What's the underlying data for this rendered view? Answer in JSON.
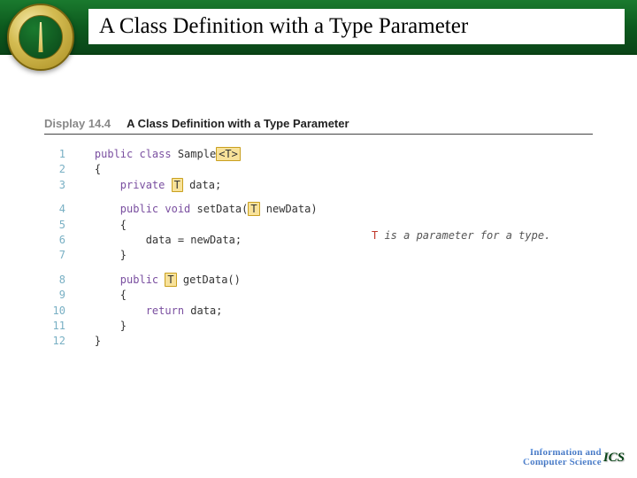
{
  "header": {
    "title": "A Class Definition with a Type Parameter"
  },
  "display": {
    "label": "Display 14.4",
    "caption": "A Class Definition with a Type Parameter"
  },
  "code": {
    "lines": [
      {
        "n": "1",
        "html": "<span class='kw'>public class</span> Sample<span class='hl'>&lt;T&gt;</span>"
      },
      {
        "n": "2",
        "html": "{"
      },
      {
        "n": "3",
        "html": "    <span class='kw'>private</span> <span class='hl'>T</span> data;"
      },
      {
        "n": "",
        "html": ""
      },
      {
        "n": "4",
        "html": "    <span class='kw'>public void</span> setData(<span class='hl'>T</span> newData)"
      },
      {
        "n": "5",
        "html": "    {"
      },
      {
        "n": "6",
        "html": "        data = newData;"
      },
      {
        "n": "7",
        "html": "    }"
      },
      {
        "n": "",
        "html": ""
      },
      {
        "n": "8",
        "html": "    <span class='kw'>public</span> <span class='hl'>T</span> getData()"
      },
      {
        "n": "9",
        "html": "    {"
      },
      {
        "n": "10",
        "html": "        <span class='kw'>return</span> data;"
      },
      {
        "n": "11",
        "html": "    }"
      },
      {
        "n": "12",
        "html": "}"
      }
    ]
  },
  "annotation": {
    "t": "T",
    "rest": " is a parameter for a type."
  },
  "footer": {
    "line1": "Information and",
    "line2": "Computer Science",
    "badge": "ICS"
  }
}
